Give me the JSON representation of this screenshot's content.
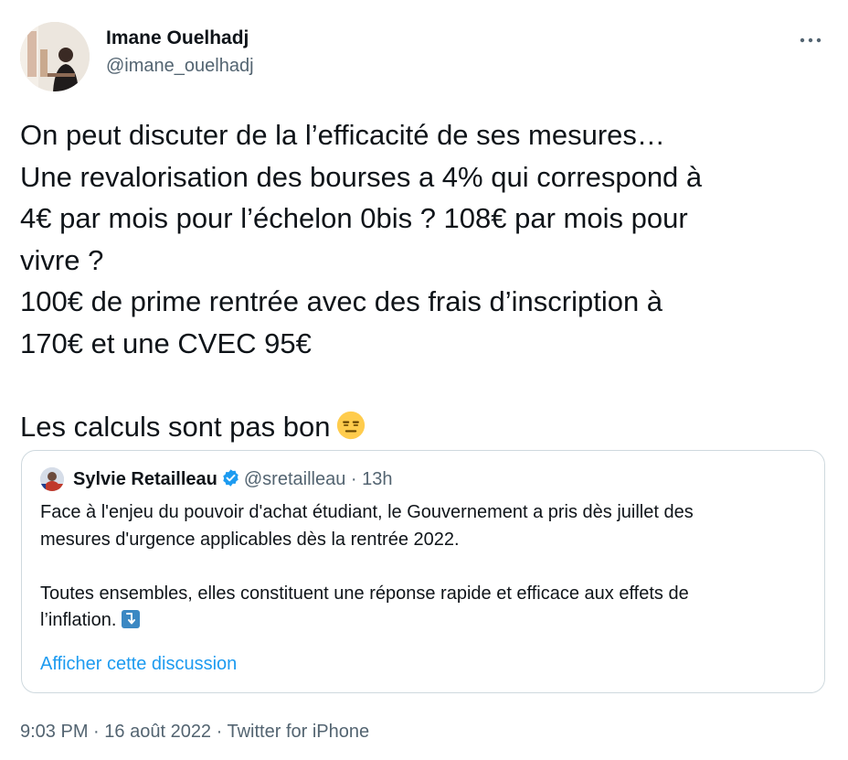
{
  "author": {
    "name": "Imane Ouelhadj",
    "handle": "@imane_ouelhadj",
    "avatar_icon": "profile-photo"
  },
  "more_icon": "more-horizontal-icon",
  "tweet": {
    "lines": [
      "On peut discuter de la l’efficacité de ses mesures…",
      "Une revalorisation des bourses a 4% qui correspond à",
      "4€ par mois pour l’échelon 0bis ? 108€ par mois pour",
      "vivre ?",
      "100€ de prime rentrée avec des frais d’inscription à",
      "170€ et une CVEC 95€"
    ],
    "last_line": "Les calculs sont pas bon",
    "emoji": "expressionless-face-emoji"
  },
  "quoted": {
    "name": "Sylvie Retailleau",
    "verified_icon": "verified-badge-icon",
    "handle": "@sretailleau",
    "separator": "·",
    "time": "13h",
    "paragraph1": [
      "Face à l'enjeu du pouvoir d'achat étudiant, le Gouvernement a pris dès juillet des",
      "mesures d'urgence applicables dès la rentrée 2022."
    ],
    "paragraph2": [
      "Toutes ensembles, elles constituent une réponse rapide et efficace aux effets de",
      "l’inflation."
    ],
    "arrow_emoji": "arrow-down-right-emoji",
    "show_thread": "Afficher cette discussion"
  },
  "meta": {
    "time": "9:03 PM",
    "sep1": "·",
    "date": "16 août 2022",
    "sep2": "·",
    "client": "Twitter for iPhone"
  },
  "colors": {
    "text": "#0f1419",
    "secondary": "#536471",
    "link": "#1d9bf0",
    "border": "#cfd9de"
  }
}
